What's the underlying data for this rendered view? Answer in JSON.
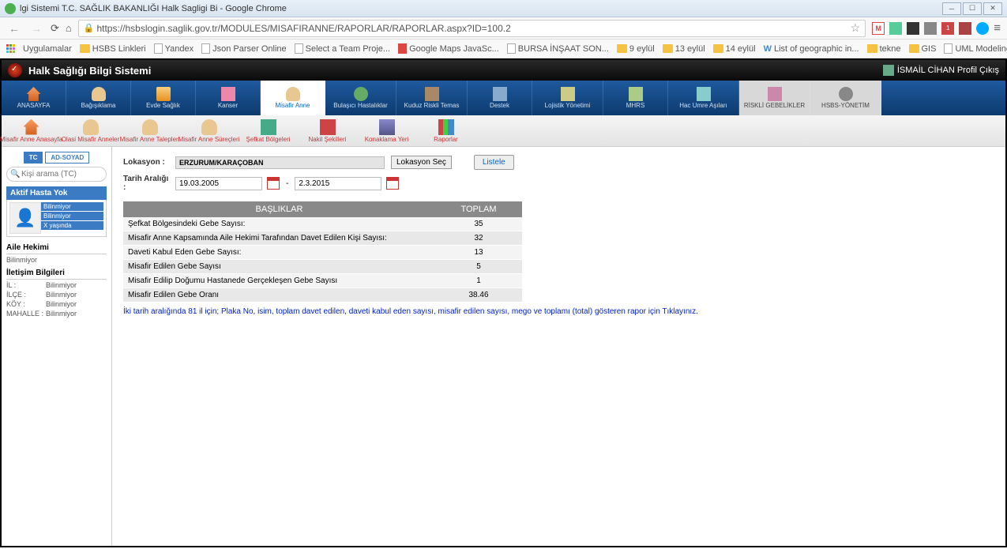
{
  "browser": {
    "title": "lgi Sistemi T.C. SAĞLIK BAKANLIĞI Halk Sagligi Bi - Google Chrome",
    "url": "https://hsbslogin.saglik.gov.tr/MODULES/MISAFIRANNE/RAPORLAR/RAPORLAR.aspx?ID=100.2",
    "bookmarks": [
      {
        "label": "Uygulamalar",
        "type": "apps"
      },
      {
        "label": "HSBS Linkleri",
        "type": "folder"
      },
      {
        "label": "Yandex",
        "type": "file"
      },
      {
        "label": "Json Parser Online",
        "type": "file"
      },
      {
        "label": "Select a Team Proje...",
        "type": "file"
      },
      {
        "label": "Google Maps JavaSc...",
        "type": "file"
      },
      {
        "label": "BURSA İNŞAAT SON...",
        "type": "file"
      },
      {
        "label": "9 eylül",
        "type": "folder"
      },
      {
        "label": "13 eylül",
        "type": "folder"
      },
      {
        "label": "14 eylül",
        "type": "folder"
      },
      {
        "label": "List of geographic in...",
        "type": "file"
      },
      {
        "label": "tekne",
        "type": "folder"
      },
      {
        "label": "GIS",
        "type": "folder"
      },
      {
        "label": "UML Modeling Soft...",
        "type": "file"
      }
    ]
  },
  "app": {
    "title": "Halk Sağlığı Bilgi Sistemi",
    "user": "İSMAİL CİHAN Profil Çıkış"
  },
  "mainnav": [
    {
      "label": "ANASAYFA"
    },
    {
      "label": "Bağışıklama"
    },
    {
      "label": "Evde Sağlık"
    },
    {
      "label": "Kanser"
    },
    {
      "label": "Misafir Anne",
      "active": true
    },
    {
      "label": "Bulaşıcı Hastalıklar"
    },
    {
      "label": "Kuduz Riskli Temas"
    },
    {
      "label": "Destek"
    },
    {
      "label": "Lojistik Yönetimi"
    },
    {
      "label": "MHRS"
    },
    {
      "label": "Hac Umre Aşıları"
    },
    {
      "label": "RİSKLİ GEBELİKLER",
      "light": true
    },
    {
      "label": "HSBS-YÖNETİM",
      "light": true
    }
  ],
  "subnav": [
    {
      "label": "Misafir Anne Anasayfa"
    },
    {
      "label": "Olasi Misafir Anneler"
    },
    {
      "label": "Misafir Anne Talepleri"
    },
    {
      "label": "Misafir Anne Süreçleri"
    },
    {
      "label": "Şefkat Bölgeleri"
    },
    {
      "label": "Nakil Şekilleri"
    },
    {
      "label": "Konaklama Yeri"
    },
    {
      "label": "Raporlar"
    }
  ],
  "left": {
    "tc": "TC",
    "ad": "AD-SOYAD",
    "search_placeholder": "Kişi arama (TC)",
    "patient_header": "Aktif Hasta Yok",
    "patient_lines": [
      "Bilinmiyor",
      "Bilinmiyor",
      "X yaşında"
    ],
    "aile_hekimi_title": "Aile Hekimi",
    "aile_hekimi_val": "Bilinmiyor",
    "iletisim_title": "İletişim Bilgileri",
    "il_lbl": "İL :",
    "il_val": "Bilinmiyor",
    "ilce_lbl": "İLÇE :",
    "ilce_val": "Bilinmiyor",
    "koy_lbl": "KÖY :",
    "koy_val": "Bilinmiyor",
    "mahalle_lbl": "MAHALLE :",
    "mahalle_val": "Bilinmiyor"
  },
  "filters": {
    "lokasyon_lbl": "Lokasyon :",
    "lokasyon_val": "ERZURUM/KARAÇOBAN",
    "lokasyon_btn": "Lokasyon Seç",
    "tarih_lbl": "Tarih Aralığı :",
    "date_from": "19.03.2005",
    "date_sep": "-",
    "date_to": "2.3.2015",
    "liste_btn": "Listele"
  },
  "table": {
    "h1": "BAŞLIKLAR",
    "h2": "TOPLAM",
    "rows": [
      {
        "k": "Şefkat Bölgesindeki Gebe Sayısı:",
        "v": "35"
      },
      {
        "k": "Misafir Anne Kapsamında Aile Hekimi Tarafından Davet Edilen Kişi Sayısı:",
        "v": "32"
      },
      {
        "k": "Daveti Kabul Eden Gebe Sayısı:",
        "v": "13"
      },
      {
        "k": "Misafir Edilen Gebe Sayısı",
        "v": "5"
      },
      {
        "k": "Misafir Edilip Doğumu Hastanede Gerçekleşen Gebe Sayısı",
        "v": "1"
      },
      {
        "k": "Misafir Edilen Gebe Oranı",
        "v": "38.46"
      }
    ]
  },
  "link_text": "İki tarih aralığında 81 il için; Plaka No, isim, toplam davet edilen, daveti kabul eden sayısı, misafir edilen sayısı, mego ve toplamı (total) gösteren rapor için Tıklayınız."
}
